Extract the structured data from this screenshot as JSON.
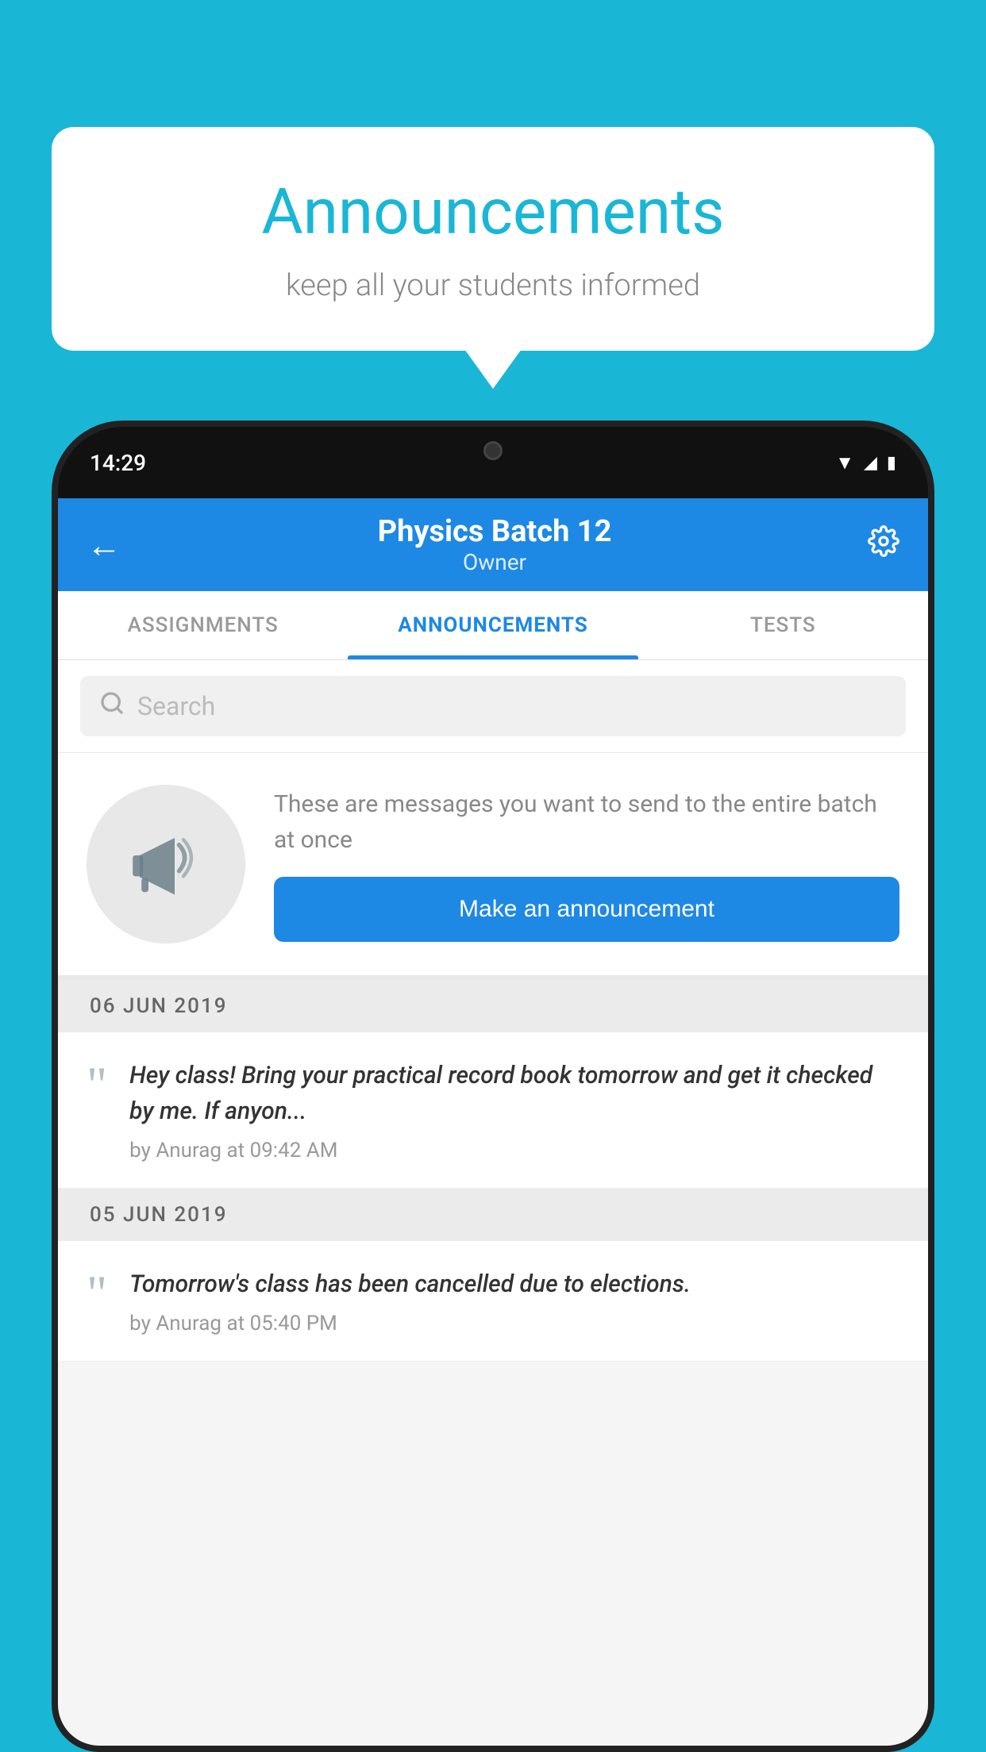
{
  "background_color": "#1ab6d6",
  "speech_bubble": {
    "title": "Announcements",
    "subtitle": "keep all your students informed"
  },
  "phone": {
    "status_bar": {
      "time": "14:29"
    },
    "header": {
      "title": "Physics Batch 12",
      "subtitle": "Owner",
      "back_label": "←"
    },
    "tabs": [
      {
        "label": "ASSIGNMENTS",
        "active": false
      },
      {
        "label": "ANNOUNCEMENTS",
        "active": true
      },
      {
        "label": "TESTS",
        "active": false
      }
    ],
    "search": {
      "placeholder": "Search"
    },
    "cta_section": {
      "description": "These are messages you want to send to the entire batch at once",
      "button_label": "Make an announcement"
    },
    "announcements": [
      {
        "date": "06  JUN  2019",
        "text": "Hey class! Bring your practical record book tomorrow and get it checked by me. If anyon...",
        "meta": "by Anurag at 09:42 AM"
      },
      {
        "date": "05  JUN  2019",
        "text": "Tomorrow's class has been cancelled due to elections.",
        "meta": "by Anurag at 05:40 PM"
      }
    ]
  }
}
